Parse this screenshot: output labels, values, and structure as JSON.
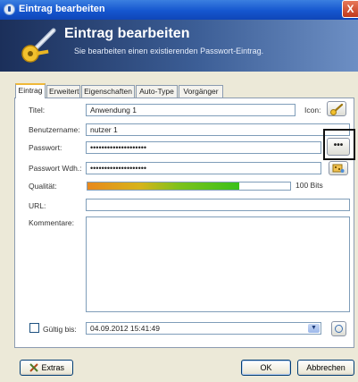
{
  "window": {
    "title": "Eintrag bearbeiten",
    "close_glyph": "X"
  },
  "banner": {
    "title": "Eintrag bearbeiten",
    "subtitle": "Sie bearbeiten einen existierenden Passwort-Eintrag."
  },
  "tabs": [
    {
      "label": "Eintrag",
      "active": true
    },
    {
      "label": "Erweitert",
      "active": false
    },
    {
      "label": "Eigenschaften",
      "active": false
    },
    {
      "label": "Auto-Type",
      "active": false
    },
    {
      "label": "Vorgänger",
      "active": false
    }
  ],
  "form": {
    "title_label": "Titel:",
    "title_value": "Anwendung 1",
    "icon_label": "Icon:",
    "username_label": "Benutzername:",
    "username_value": "nutzer 1",
    "password_label": "Passwort:",
    "password_value": "••••••••••••••••••••",
    "password_repeat_label": "Passwort Wdh.:",
    "password_repeat_value": "••••••••••••••••••••",
    "show_password_glyph": "•••",
    "quality_label": "Qualität:",
    "quality_text": "100 Bits",
    "quality_fraction": 0.75,
    "url_label": "URL:",
    "url_value": "",
    "comments_label": "Kommentare:",
    "comments_value": "",
    "expiry_label": "Gültig bis:",
    "expiry_value": "04.09.2012 15:41:49",
    "expiry_checked": false
  },
  "buttons": {
    "tools": "Extras",
    "ok": "OK",
    "cancel": "Abbrechen"
  },
  "icons": {
    "window": "app-icon",
    "banner": "key-icon",
    "entry_icon": "key-icon",
    "generator": "password-generator-icon",
    "calendar": "clock-icon",
    "tools": "tools-icon"
  },
  "colors": {
    "titlebar": "#1556cf",
    "highlight_border": "#111111",
    "quality_start": "#e8891d",
    "quality_end": "#39c11a"
  }
}
